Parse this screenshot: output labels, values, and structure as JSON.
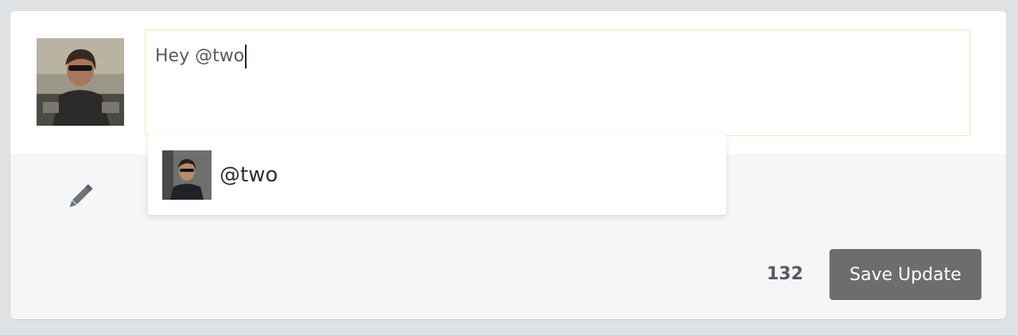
{
  "composer": {
    "text": "Hey @two",
    "avatar_icon": "user-avatar-icon"
  },
  "mention_suggestions": [
    {
      "handle": "@two",
      "avatar_icon": "user-avatar-icon"
    }
  ],
  "footer": {
    "edit_icon": "pencil-icon",
    "char_count": "132",
    "save_label": "Save Update"
  },
  "colors": {
    "page_background": "#dfe2e5",
    "card_background": "#f5f6f8",
    "input_border": "#f3e6b8",
    "button_background": "#6b6d6f",
    "button_text": "#ffffff",
    "text": "#555a60"
  }
}
